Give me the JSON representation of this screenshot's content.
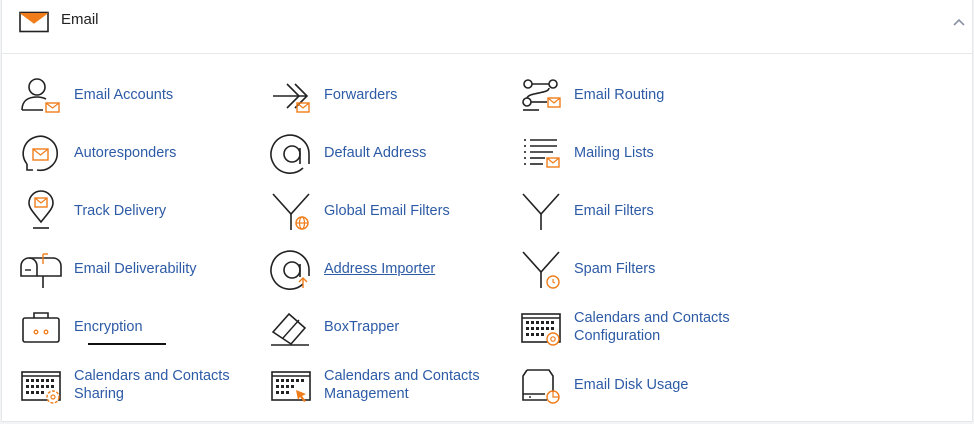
{
  "section": {
    "title": "Email",
    "collapse_icon": "chevron-up-icon",
    "header_icon": "envelope-icon"
  },
  "colors": {
    "accent": "#f07d1a",
    "link": "#2d5ba6",
    "icon_stroke": "#222222"
  },
  "items": [
    {
      "label": "Email Accounts",
      "icon": "user-mail-icon"
    },
    {
      "label": "Forwarders",
      "icon": "forward-mail-icon"
    },
    {
      "label": "Email Routing",
      "icon": "routing-icon"
    },
    {
      "label": "Autoresponders",
      "icon": "auto-reply-icon"
    },
    {
      "label": "Default Address",
      "icon": "at-sign-icon"
    },
    {
      "label": "Mailing Lists",
      "icon": "list-mail-icon"
    },
    {
      "label": "Track Delivery",
      "icon": "map-pin-mail-icon"
    },
    {
      "label": "Global Email Filters",
      "icon": "funnel-globe-icon"
    },
    {
      "label": "Email Filters",
      "icon": "funnel-icon"
    },
    {
      "label": "Email Deliverability",
      "icon": "mailbox-icon"
    },
    {
      "label": "Address Importer",
      "icon": "at-sign-upload-icon"
    },
    {
      "label": "Spam Filters",
      "icon": "funnel-clock-icon"
    },
    {
      "label": "Encryption",
      "icon": "briefcase-lock-icon"
    },
    {
      "label": "BoxTrapper",
      "icon": "box-trap-icon"
    },
    {
      "label": "Calendars and Contacts Configuration",
      "icon": "calendar-at-icon"
    },
    {
      "label": "Calendars and Contacts Sharing",
      "icon": "calendar-gear-icon"
    },
    {
      "label": "Calendars and Contacts Management",
      "icon": "calendar-cursor-icon"
    },
    {
      "label": "Email Disk Usage",
      "icon": "disk-usage-icon"
    }
  ]
}
